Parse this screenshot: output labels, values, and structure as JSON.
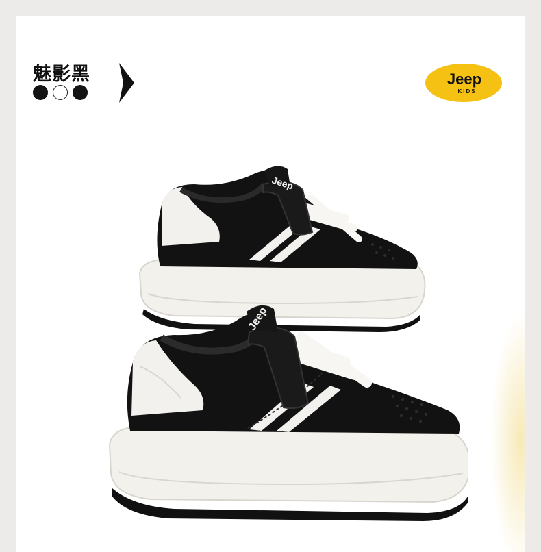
{
  "variant": {
    "name": "魅影黑",
    "swatches": [
      {
        "label": "black",
        "color": "#141414"
      },
      {
        "label": "white",
        "color": "#ffffff"
      },
      {
        "label": "black",
        "color": "#141414"
      }
    ]
  },
  "logo": {
    "brand": "Jeep",
    "sub": "KIDS",
    "background": "#f5c113"
  },
  "shoe": {
    "upper_color": "#111111",
    "stripe_color": "#f2f1ee",
    "sole_color": "#f3f1ec",
    "lace_color": "#f7f6f3",
    "tongue_brand": "Jeep"
  }
}
